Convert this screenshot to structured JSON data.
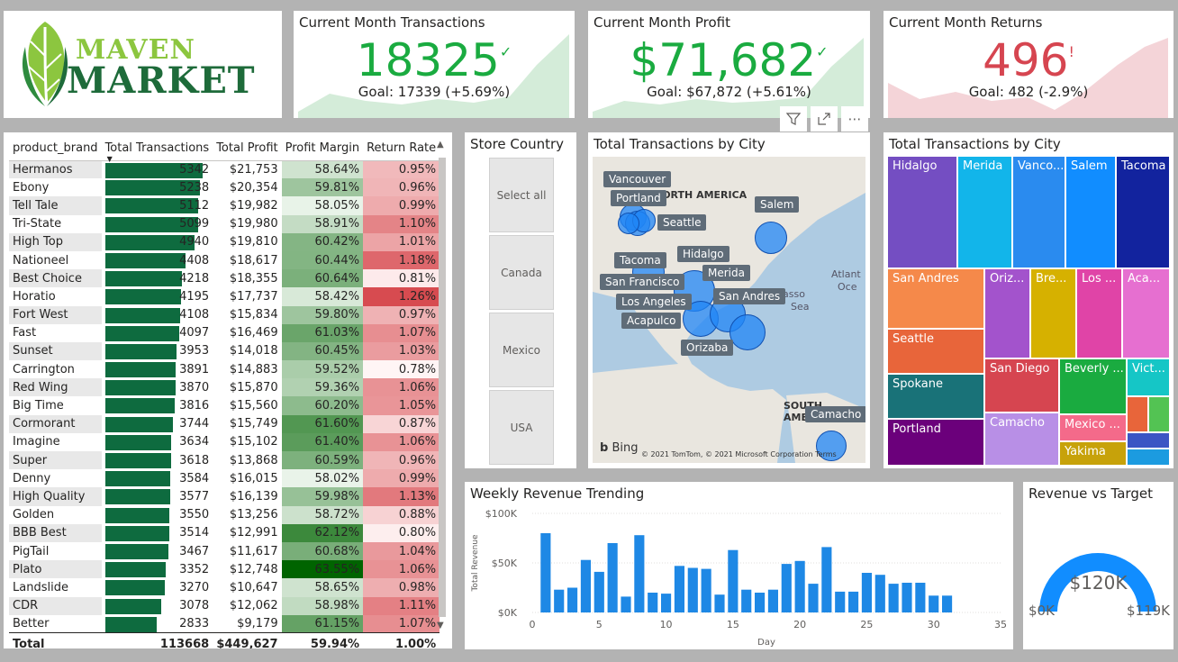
{
  "logo": {
    "line1": "MAVEN",
    "line2": "MARKET"
  },
  "kpis": {
    "transactions": {
      "title": "Current Month Transactions",
      "value": "18325",
      "mark": "✓",
      "goal": "Goal: 17339 (+5.69%)",
      "color": "#1aab40",
      "area_color": "#d4ecd9"
    },
    "profit": {
      "title": "Current Month Profit",
      "value": "$71,682",
      "mark": "✓",
      "goal": "Goal: $67,872 (+5.61%)",
      "color": "#1aab40",
      "area_color": "#d4ecd9"
    },
    "returns": {
      "title": "Current Month Returns",
      "value": "496",
      "mark": "!",
      "goal": "Goal: 482 (-2.9%)",
      "color": "#d64550",
      "area_color": "#f4d4d8"
    }
  },
  "visual_header": {
    "filter": "filter-icon",
    "focus": "focus-mode-icon",
    "more": "⋯"
  },
  "table": {
    "columns": [
      "product_brand",
      "Total Transactions",
      "Total Profit",
      "Profit Margin",
      "Return Rate"
    ],
    "sorted_column": "Total Transactions",
    "rows": [
      [
        "Hermanos",
        5342,
        "$21,753",
        "58.64%",
        "0.95%"
      ],
      [
        "Ebony",
        5238,
        "$20,354",
        "59.81%",
        "0.96%"
      ],
      [
        "Tell Tale",
        5112,
        "$19,982",
        "58.05%",
        "0.99%"
      ],
      [
        "Tri-State",
        5099,
        "$19,980",
        "58.91%",
        "1.10%"
      ],
      [
        "High Top",
        4940,
        "$19,810",
        "60.42%",
        "1.01%"
      ],
      [
        "Nationeel",
        4408,
        "$18,617",
        "60.44%",
        "1.18%"
      ],
      [
        "Best Choice",
        4218,
        "$18,355",
        "60.64%",
        "0.81%"
      ],
      [
        "Horatio",
        4195,
        "$17,737",
        "58.42%",
        "1.26%"
      ],
      [
        "Fort West",
        4108,
        "$15,834",
        "59.80%",
        "0.97%"
      ],
      [
        "Fast",
        4097,
        "$16,469",
        "61.03%",
        "1.07%"
      ],
      [
        "Sunset",
        3953,
        "$14,018",
        "60.45%",
        "1.03%"
      ],
      [
        "Carrington",
        3891,
        "$14,883",
        "59.52%",
        "0.78%"
      ],
      [
        "Red Wing",
        3870,
        "$15,870",
        "59.36%",
        "1.06%"
      ],
      [
        "Big Time",
        3816,
        "$15,560",
        "60.20%",
        "1.05%"
      ],
      [
        "Cormorant",
        3744,
        "$15,749",
        "61.60%",
        "0.87%"
      ],
      [
        "Imagine",
        3634,
        "$15,102",
        "61.40%",
        "1.06%"
      ],
      [
        "Super",
        3618,
        "$13,868",
        "60.59%",
        "0.96%"
      ],
      [
        "Denny",
        3584,
        "$16,015",
        "58.02%",
        "0.99%"
      ],
      [
        "High Quality",
        3577,
        "$16,139",
        "59.98%",
        "1.13%"
      ],
      [
        "Golden",
        3550,
        "$13,256",
        "58.72%",
        "0.88%"
      ],
      [
        "BBB Best",
        3514,
        "$12,991",
        "62.12%",
        "0.80%"
      ],
      [
        "PigTail",
        3467,
        "$11,617",
        "60.68%",
        "1.04%"
      ],
      [
        "Plato",
        3352,
        "$12,748",
        "63.55%",
        "1.06%"
      ],
      [
        "Landslide",
        3270,
        "$10,647",
        "58.65%",
        "0.98%"
      ],
      [
        "CDR",
        3078,
        "$12,062",
        "58.98%",
        "1.11%"
      ],
      [
        "Better",
        2833,
        "$9,179",
        "61.15%",
        "1.07%"
      ]
    ],
    "total": [
      "Total",
      "113668",
      "$449,627",
      "59.94%",
      "1.00%"
    ]
  },
  "slicer": {
    "title": "Store Country",
    "options": [
      "Select all",
      "Canada",
      "Mexico",
      "USA"
    ]
  },
  "map": {
    "title": "Total Transactions by City",
    "attribution": "© 2021 TomTom, © 2021 Microsoft Corporation  Terms",
    "bing": "Bing",
    "regions": [
      "NORTH AMERICA",
      "SOUTH AMERICA"
    ],
    "oceans": [
      "Atlant",
      "Oce",
      "Sargasso",
      "Sea"
    ],
    "cities": [
      "Vancouver",
      "Portland",
      "Seattle",
      "Salem",
      "Hidalgo",
      "Tacoma",
      "Merida",
      "San Francisco",
      "San Andres",
      "Los Angeles",
      "Acapulco",
      "Orizaba",
      "Camacho"
    ]
  },
  "treemap": {
    "title": "Total Transactions by City",
    "tiles": [
      {
        "label": "Hidalgo",
        "color": "#744ec2"
      },
      {
        "label": "Merida",
        "color": "#12b5ea"
      },
      {
        "label": "Vanco...",
        "color": "#2a8bef"
      },
      {
        "label": "Salem",
        "color": "#118dff"
      },
      {
        "label": "Tacoma",
        "color": "#12239e"
      },
      {
        "label": "San Andres",
        "color": "#f5894a"
      },
      {
        "label": "Oriz...",
        "color": "#a353cc"
      },
      {
        "label": "Bre...",
        "color": "#d6b100"
      },
      {
        "label": "Los ...",
        "color": "#e044a7"
      },
      {
        "label": "Aca...",
        "color": "#e66fd0"
      },
      {
        "label": "Seattle",
        "color": "#e8653a"
      },
      {
        "label": "Spokane",
        "color": "#197278"
      },
      {
        "label": "Portland",
        "color": "#6b007b"
      },
      {
        "label": "San Diego",
        "color": "#d64550"
      },
      {
        "label": "Camacho",
        "color": "#b88fe6"
      },
      {
        "label": "Beverly ...",
        "color": "#1aab40"
      },
      {
        "label": "Vict...",
        "color": "#15c6c6"
      },
      {
        "label": "Mexico ...",
        "color": "#f46a8a"
      },
      {
        "label": "Yakima",
        "color": "#c7a20a"
      },
      {
        "label": "",
        "color": "#e8653a"
      },
      {
        "label": "",
        "color": "#53c353"
      },
      {
        "label": "",
        "color": "#3b55c4"
      },
      {
        "label": "",
        "color": "#1c9be0"
      }
    ]
  },
  "chart_data": [
    {
      "type": "bar",
      "title": "Weekly Revenue Trending",
      "xlabel": "Day",
      "ylabel": "Total Revenue",
      "ylim": [
        0,
        100000
      ],
      "xlim": [
        0,
        35
      ],
      "x_ticks": [
        "0",
        "5",
        "10",
        "15",
        "20",
        "25",
        "30",
        "35"
      ],
      "y_ticks": [
        "$0K",
        "$50K",
        "$100K"
      ],
      "x": [
        1,
        2,
        3,
        4,
        5,
        6,
        7,
        8,
        9,
        10,
        11,
        12,
        13,
        14,
        15,
        16,
        17,
        18,
        19,
        20,
        21,
        22,
        23,
        24,
        25,
        26,
        27,
        28,
        29,
        30,
        31,
        32,
        33
      ],
      "values": [
        80000,
        23000,
        25000,
        53000,
        41000,
        70000,
        16000,
        78000,
        20000,
        19000,
        47000,
        45000,
        44000,
        18000,
        63000,
        23000,
        20000,
        23000,
        49000,
        52000,
        29000,
        66000,
        21000,
        21000,
        40000,
        38000,
        29000,
        30000,
        30000,
        17000,
        17000,
        0,
        0
      ],
      "bar_color": "#1e88e5"
    },
    {
      "type": "gauge",
      "title": "Revenue vs Target",
      "value": "$120K",
      "min": "$0K",
      "max": "$119K",
      "fill_color": "#118dff"
    }
  ]
}
